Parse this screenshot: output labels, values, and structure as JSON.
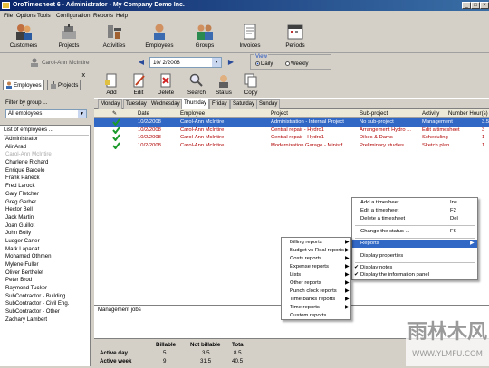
{
  "window": {
    "title": "OroTimesheet 6 - Administrator - My Company Demo Inc."
  },
  "menu": [
    "File",
    "Options",
    "Tools",
    "Configuration",
    "Reports",
    "Help"
  ],
  "toolbar": [
    {
      "label": "Customers",
      "icon": "customers-icon"
    },
    {
      "label": "Projects",
      "icon": "projects-icon"
    },
    {
      "label": "Activities",
      "icon": "activities-icon"
    },
    {
      "label": "Employees",
      "icon": "employees-icon"
    },
    {
      "label": "Groups",
      "icon": "groups-icon"
    },
    {
      "label": "Invoices",
      "icon": "invoices-icon"
    },
    {
      "label": "Periods",
      "icon": "periods-icon"
    }
  ],
  "current_user": "Carol-Ann McIntire",
  "date_value": "10/ 2/2008",
  "view": {
    "title": "View",
    "daily": "Daily",
    "weekly": "Weekly",
    "selected": "Daily"
  },
  "left_panel": {
    "tabs": [
      "Employees",
      "Projects"
    ],
    "close": "x",
    "filter_label": "Filter by group ...",
    "filter_value": "All employees",
    "list_header": "List of employees ...",
    "employees": [
      "Administrator",
      "Alir Arad",
      "Carol-Ann McIntire",
      "Charlene Richard",
      "Enrique Barcelo",
      "Frank Paneck",
      "Fred Larock",
      "Gary Fletcher",
      "Greg Gerber",
      "Hector Bell",
      "Jack Martin",
      "Joan Guillot",
      "John Boily",
      "Ludger Carter",
      "Mark Lapadat",
      "Mohamed Othmen",
      "Mylene Fuller",
      "Oliver Berthelet",
      "Peter Brod",
      "Raymond Tucker",
      "SubContractor - Building",
      "SubContractor - Civil Eng.",
      "SubContractor - Other",
      "Zachary Lambert"
    ],
    "selected_employee": "Carol-Ann McIntire"
  },
  "action_toolbar": [
    "Add",
    "Edit",
    "Delete",
    "Search",
    "Status",
    "Copy"
  ],
  "day_tabs": [
    "Monday",
    "Tuesday",
    "Wednesday",
    "Thursday",
    "Friday",
    "Saturday",
    "Sunday"
  ],
  "active_day": "Thursday",
  "grid": {
    "columns": [
      "Date",
      "Employee",
      "Project",
      "Sub-project",
      "Activity",
      "Number Hour(s)"
    ],
    "rows": [
      {
        "date": "10/2/2008",
        "employee": "Carol-Ann McIntire",
        "project": "Administration - Internal  Project",
        "subproject": "No sub-project",
        "activity": "Management",
        "hours": "3.5",
        "selected": true
      },
      {
        "date": "10/2/2008",
        "employee": "Carol-Ann McIntire",
        "project": "Central repair - Hydro1",
        "subproject": "Arrangement Hydro ...",
        "activity": "Edit a timesheet",
        "hours": "3"
      },
      {
        "date": "10/2/2008",
        "employee": "Carol-Ann McIntire",
        "project": "Central repair - Hydro1",
        "subproject": "Dikes & Dams",
        "activity": "Scheduling",
        "hours": "1"
      },
      {
        "date": "10/2/2008",
        "employee": "Carol-Ann McIntire",
        "project": "Modernization Garage - Ministf",
        "subproject": "Preliminary studies",
        "activity": "Sketch plan",
        "hours": "1"
      }
    ]
  },
  "management_label": "Management jobs",
  "totals": {
    "headers": [
      "Billable",
      "Not billable",
      "Total"
    ],
    "rows": [
      {
        "label": "Active day",
        "billable": "5",
        "not_billable": "3.5",
        "total": "8.5"
      },
      {
        "label": "Active week",
        "billable": "9",
        "not_billable": "31.5",
        "total": "40.5"
      }
    ]
  },
  "context_menu": {
    "items": [
      {
        "label": "Add a timesheet",
        "shortcut": "Ins"
      },
      {
        "label": "Edit a timesheet",
        "shortcut": "F2"
      },
      {
        "label": "Delete a timesheet",
        "shortcut": "Del"
      },
      {
        "label": "Change the status ...",
        "shortcut": "F6"
      },
      {
        "label": "Reports",
        "submenu": true,
        "highlighted": true
      },
      {
        "label": "Display properties"
      },
      {
        "label": "Display notes",
        "checked": true
      },
      {
        "label": "Display the information panel",
        "checked": true
      }
    ]
  },
  "reports_submenu": [
    "Billing reports",
    "Budget vs Real reports",
    "Costs reports",
    "Expense reports",
    "Lists",
    "Other reports",
    "Punch clock reports",
    "Time banks reports",
    "Time reports",
    "Custom reports ..."
  ],
  "watermark": {
    "text": "雨林木风",
    "url": "WWW.YLMFU.COM"
  },
  "colors": {
    "title_bar": "#0a246a",
    "selection": "#3168c6",
    "red_text": "#b00000"
  }
}
